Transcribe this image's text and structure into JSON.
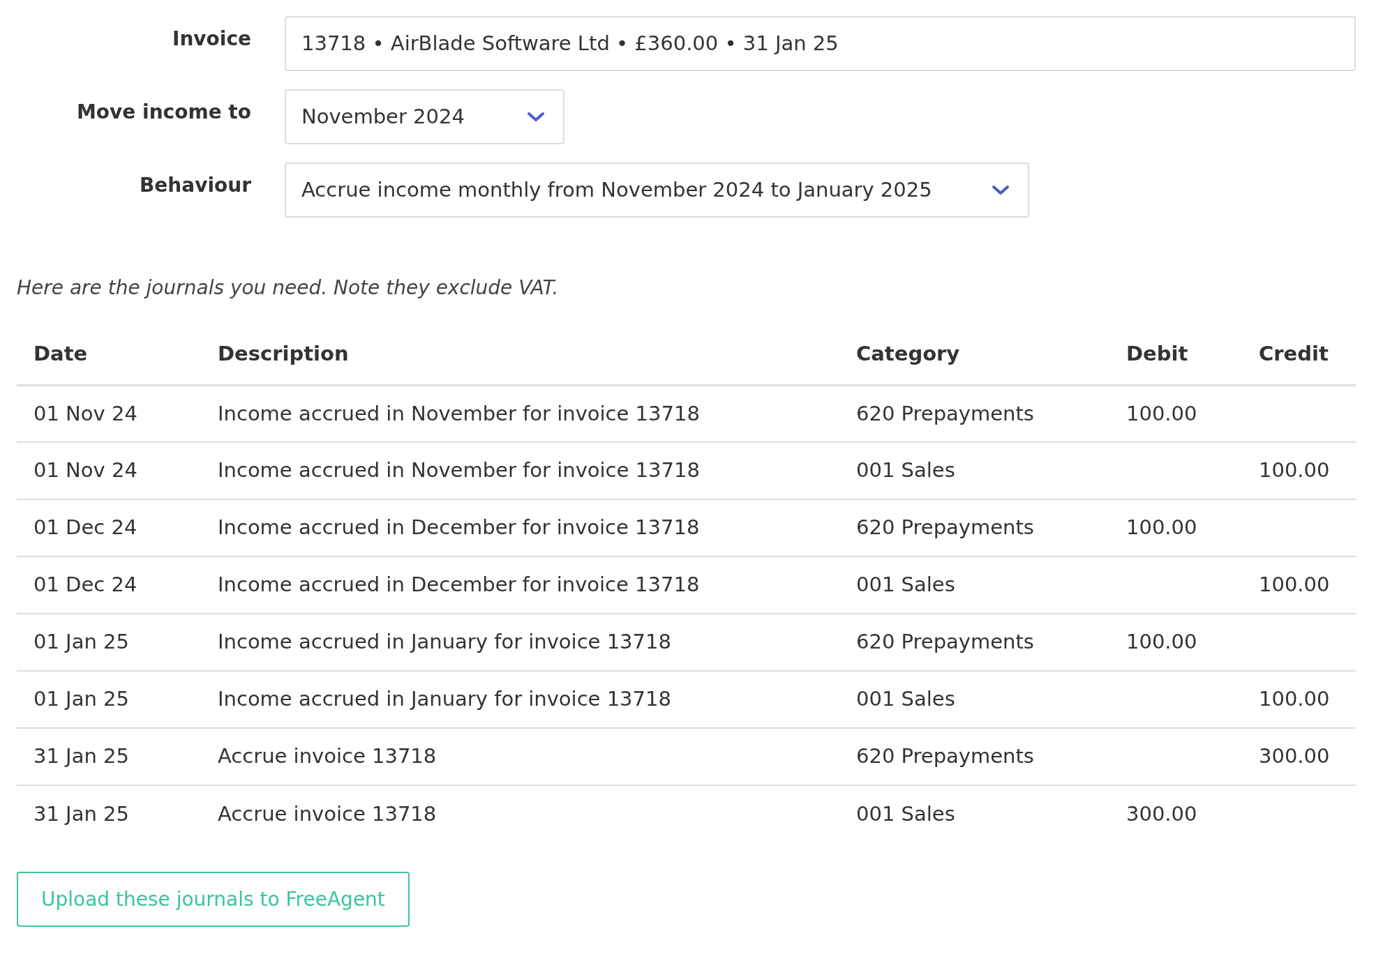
{
  "form": [
    {
      "label": "Invoice",
      "kind": "text",
      "value": "13718 • AirBlade Software Ltd • £360.00 • 31 Jan 25"
    },
    {
      "label": "Move income to",
      "kind": "select",
      "value": "November 2024"
    },
    {
      "label": "Behaviour",
      "kind": "select",
      "value": "Accrue income monthly from November 2024 to January 2025"
    }
  ],
  "note": "Here are the journals you need. Note they exclude VAT.",
  "table": {
    "columns": [
      "Date",
      "Description",
      "Category",
      "Debit",
      "Credit"
    ],
    "rows": [
      [
        "01 Nov 24",
        "Income accrued in November for invoice 13718",
        "620 Prepayments",
        "100.00",
        ""
      ],
      [
        "01 Nov 24",
        "Income accrued in November for invoice 13718",
        "001 Sales",
        "",
        "100.00"
      ],
      [
        "01 Dec 24",
        "Income accrued in December for invoice 13718",
        "620 Prepayments",
        "100.00",
        ""
      ],
      [
        "01 Dec 24",
        "Income accrued in December for invoice 13718",
        "001 Sales",
        "",
        "100.00"
      ],
      [
        "01 Jan 25",
        "Income accrued in January for invoice 13718",
        "620 Prepayments",
        "100.00",
        ""
      ],
      [
        "01 Jan 25",
        "Income accrued in January for invoice 13718",
        "001 Sales",
        "",
        "100.00"
      ],
      [
        "31 Jan 25",
        "Accrue invoice 13718",
        "620 Prepayments",
        "",
        "300.00"
      ],
      [
        "31 Jan 25",
        "Accrue invoice 13718",
        "001 Sales",
        "300.00",
        ""
      ]
    ]
  },
  "button": "Upload these journals to FreeAgent"
}
